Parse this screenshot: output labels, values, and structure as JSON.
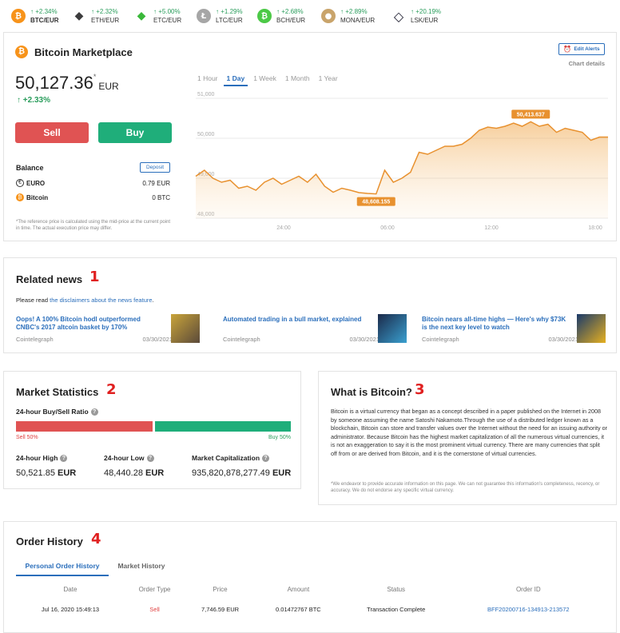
{
  "ticker": [
    {
      "pair": "BTC/EUR",
      "change": "+2.34%",
      "color": "#f7931a",
      "glyph": "₿",
      "selected": true
    },
    {
      "pair": "ETH/EUR",
      "change": "+2.32%",
      "color": "#3c3c3d",
      "glyph": "◆"
    },
    {
      "pair": "ETC/EUR",
      "change": "+5.00%",
      "color": "#3ab83a",
      "glyph": "◆"
    },
    {
      "pair": "LTC/EUR",
      "change": "+1.29%",
      "color": "#a6a6a6",
      "glyph": "Ł"
    },
    {
      "pair": "BCH/EUR",
      "change": "+2.68%",
      "color": "#4cc947",
      "glyph": "₿"
    },
    {
      "pair": "MONA/EUR",
      "change": "+2.89%",
      "color": "#c9a46b",
      "glyph": "●"
    },
    {
      "pair": "LSK/EUR",
      "change": "+20.19%",
      "color": "#1a1a2e",
      "glyph": "◇"
    }
  ],
  "market": {
    "title": "Bitcoin Marketplace",
    "price": "50,127.36",
    "asterisk": "*",
    "currency": "EUR",
    "change": "+2.33%",
    "sell_label": "Sell",
    "buy_label": "Buy",
    "balance_label": "Balance",
    "deposit_label": "Deposit",
    "euro_label": "EURO",
    "euro_value": "0.79 EUR",
    "btc_label": "Bitcoin",
    "btc_value": "0 BTC",
    "note": "*The reference price is calculated using the mid-price at the current point in time. The actual execution price may differ.",
    "edit_alerts": "Edit Alerts",
    "chart_details": "Chart details",
    "ranges": [
      "1 Hour",
      "1 Day",
      "1 Week",
      "1 Month",
      "1 Year"
    ],
    "active_range": "1 Day"
  },
  "chart_data": {
    "type": "area",
    "y_ticks": [
      "51,000",
      "50,000",
      "49,000",
      "48,000"
    ],
    "x_ticks": [
      "24:00",
      "06:00",
      "12:00",
      "18:00"
    ],
    "ylim": [
      48000,
      51000
    ],
    "high_label": "50,413.637",
    "low_label": "48,608.155",
    "values": [
      49050,
      49200,
      49000,
      48900,
      48950,
      48750,
      48800,
      48700,
      48900,
      49000,
      48850,
      48950,
      49050,
      48900,
      49100,
      48800,
      48650,
      48750,
      48700,
      48640,
      48620,
      48608,
      49200,
      48900,
      49000,
      49150,
      49650,
      49600,
      49700,
      49800,
      49800,
      49850,
      50000,
      50200,
      50280,
      50250,
      50300,
      50380,
      50300,
      50413,
      50300,
      50350,
      50150,
      50250,
      50200,
      50150,
      49950,
      50030,
      50030
    ]
  },
  "news": {
    "title": "Related news",
    "number": "1",
    "disclaimer_prefix": "Please read ",
    "disclaimer_link": "the disclaimers about the news feature",
    "disclaimer_suffix": ".",
    "items": [
      {
        "title": "Oops! A 100% Bitcoin hodl outperformed CNBC's 2017 altcoin basket by 170%",
        "source": "Cointelegraph",
        "date": "03/30/2021"
      },
      {
        "title": "Automated trading in a bull market, explained",
        "source": "Cointelegraph",
        "date": "03/30/2021"
      },
      {
        "title": "Bitcoin nears all-time highs — Here's why $73K is the next key level to watch",
        "source": "Cointelegraph",
        "date": "03/30/2021"
      }
    ]
  },
  "stats": {
    "title": "Market Statistics",
    "number": "2",
    "ratio_label": "24-hour Buy/Sell Ratio",
    "sell_pct": "Sell 50%",
    "buy_pct": "Buy 50%",
    "sell_fraction": 0.5,
    "high_label": "24-hour High",
    "high_value": "50,521.85",
    "low_label": "24-hour Low",
    "low_value": "48,440.28",
    "cap_label": "Market Capitalization",
    "cap_value": "935,820,878,277.49",
    "unit": "EUR"
  },
  "about": {
    "title": "What is Bitcoin?",
    "number": "3",
    "text": "Bitcoin is a virtual currency that began as a concept described in a paper published on the Internet in 2008 by someone assuming the name Satoshi Nakamoto.Through the use of a distributed ledger known as a blockchain, Bitcoin can store and transfer values over the Internet without the need for an issuing authority or administrator. Because Bitcoin has the highest market capitalization of all the numerous virtual currencies, it is not an exaggeration to say it is the most prominent virtual currency. There are many currencies that split off from or are derived from Bitcoin, and it is the cornerstone of virtual currencies.",
    "note": "*We endeavor to provide accurate information on this page. We can not guarantee this information's completeness, recency, or accuracy. We do not endorse any specific virtual currency."
  },
  "orders": {
    "title": "Order History",
    "number": "4",
    "tabs": [
      "Personal Order History",
      "Market History"
    ],
    "headers": [
      "Date",
      "Order Type",
      "Price",
      "Amount",
      "Status",
      "Order ID"
    ],
    "rows": [
      [
        "Jul 16, 2020 15:49:13",
        "Sell",
        "7,746.59 EUR",
        "0.01472767 BTC",
        "Transaction Complete",
        "BFF20200716-134913-213572"
      ]
    ]
  }
}
